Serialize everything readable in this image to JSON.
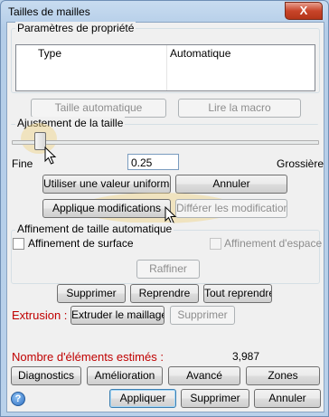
{
  "window": {
    "title": "Tailles de mailles",
    "close_glyph": "X"
  },
  "properties": {
    "legend": "Paramètres de propriété",
    "columns": [
      "Type",
      "Automatique"
    ]
  },
  "top_buttons": {
    "auto_size": "Taille automatique",
    "read_macro": "Lire la macro"
  },
  "size_adjust": {
    "legend": "Ajustement de la taille",
    "fine_label": "Fine",
    "coarse_label": "Grossière",
    "slider_level": 0.1,
    "value": "0.25",
    "use_uniform": "Utiliser une valeur uniforme",
    "cancel": "Annuler",
    "apply_changes": "Applique modifications",
    "defer_changes": "Différer les modifications"
  },
  "auto_refine": {
    "legend": "Affinement de taille automatique",
    "surface_label": "Affinement de surface",
    "space_label": "Affinement d'espace",
    "refine": "Raffiner"
  },
  "edit_buttons": {
    "delete": "Supprimer",
    "redo": "Reprendre",
    "redo_all": "Tout reprendre"
  },
  "extrusion": {
    "label": "Extrusion :",
    "extrude": "Extruder le maillage",
    "delete": "Supprimer"
  },
  "estimate": {
    "label": "Nombre d'éléments estimés :",
    "value": "3,987"
  },
  "bottom_tabs": {
    "diagnostics": "Diagnostics",
    "improve": "Amélioration",
    "advanced": "Avancé",
    "zones": "Zones"
  },
  "footer": {
    "help_glyph": "?",
    "apply": "Appliquer",
    "delete": "Supprimer",
    "cancel": "Annuler"
  },
  "colors": {
    "accent_red": "#c00000",
    "window_frame": "#b9d1ea"
  }
}
